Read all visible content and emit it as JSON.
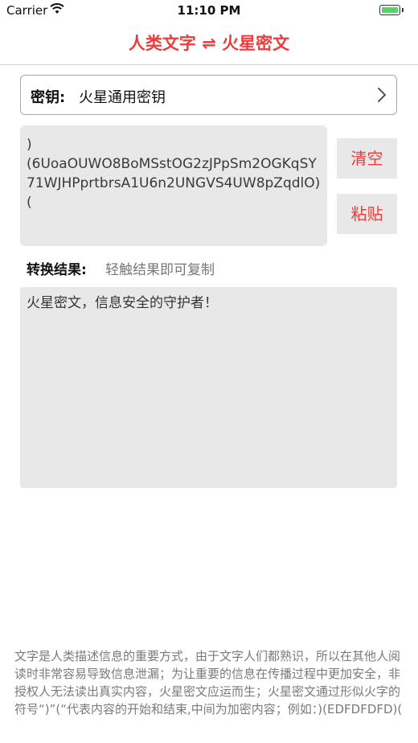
{
  "status_bar": {
    "carrier": "Carrier",
    "time": "11:10 PM",
    "icons": [
      "wifi-icon",
      "battery-icon"
    ]
  },
  "nav": {
    "title": "人类文字 ⇌ 火星密文"
  },
  "key_selector": {
    "label": "密钥:",
    "value": "火星通用密钥",
    "icon": "chevron-right-icon"
  },
  "input": {
    "text": ")\n(6UoaOUWO8BoMSstOG2zJPpSm2OGKqSY71WJHPprtbrsA1U6n2UNGVS4UW8pZqdlO)("
  },
  "buttons": {
    "clear": "清空",
    "paste": "粘贴"
  },
  "result": {
    "label": "转换结果:",
    "hint": "轻触结果即可复制",
    "text": "火星密文，信息安全的守护者！"
  },
  "footer": {
    "description": "文字是人类描述信息的重要方式，由于文字人们都熟识，所以在其他人阅读时非常容易导致信息泄漏；为让重要的信息在传播过程中更加安全，非授权人无法读出真实内容，火星密文应运而生；火星密文通过形似火字的符号“)”(“代表内容的开始和结束,中间为加密内容；例如：)(EDFDFDFD)("
  },
  "colors": {
    "accent": "#ee3b3b",
    "panel": "#e8e8e8",
    "battery": "#4cd964"
  }
}
